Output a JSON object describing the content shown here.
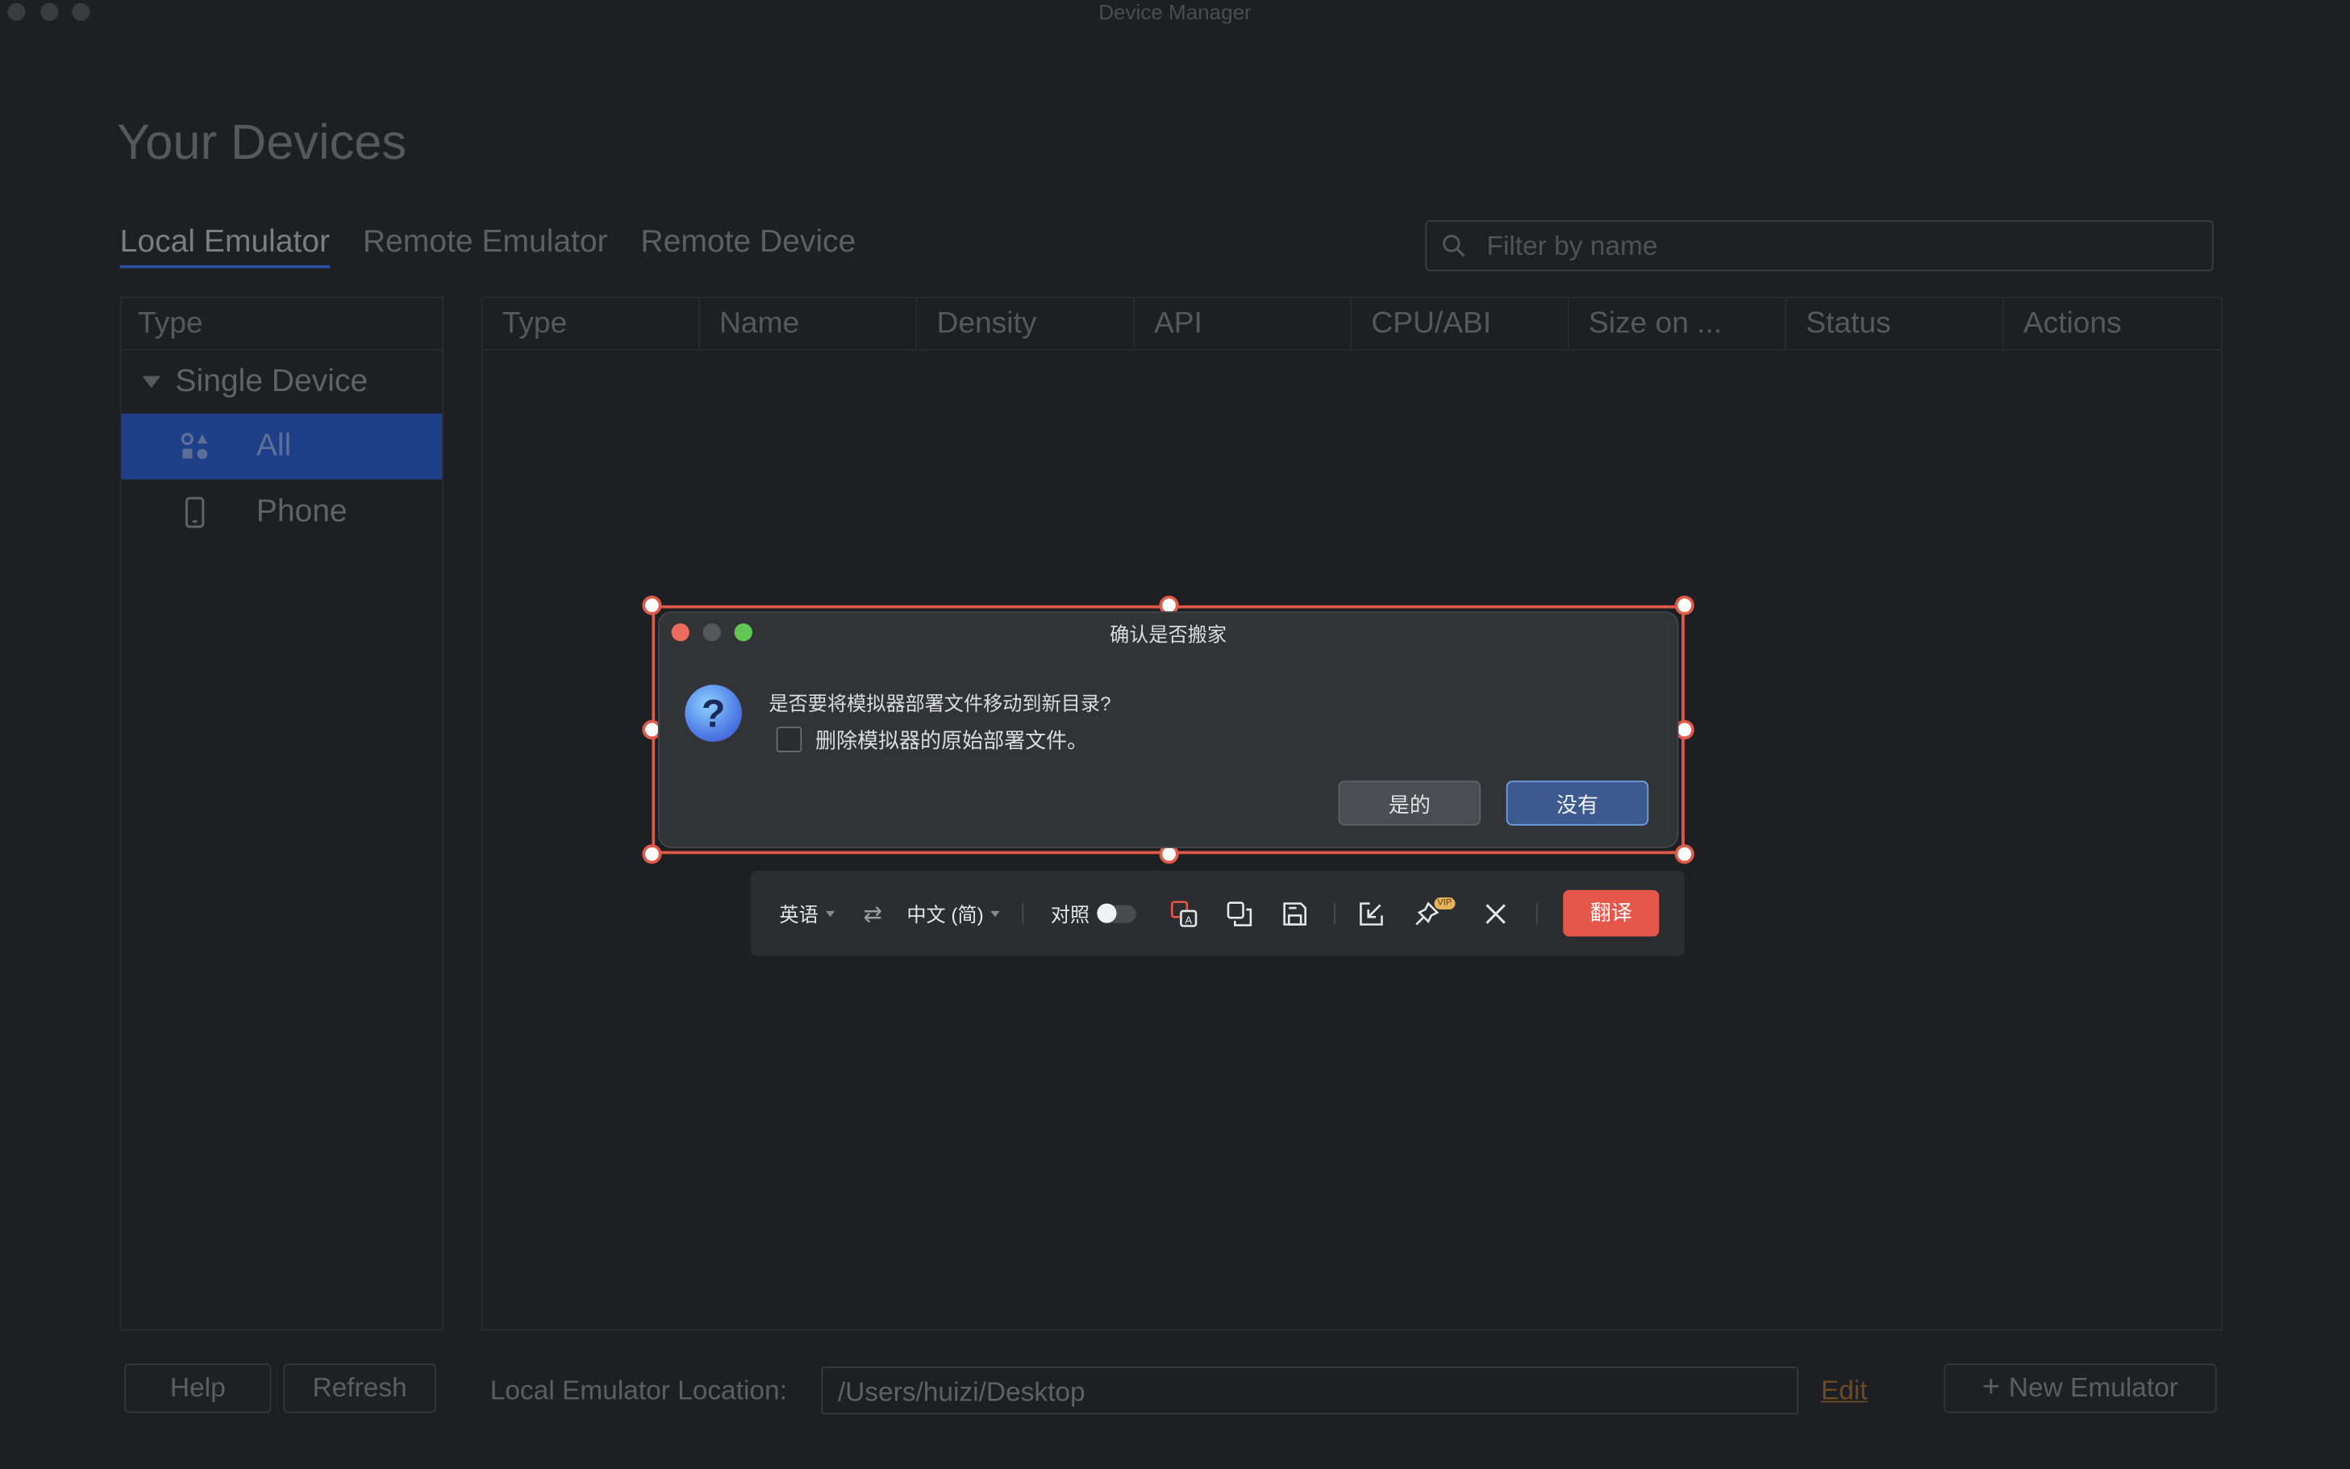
{
  "window": {
    "title": "Device Manager"
  },
  "page": {
    "title": "Your Devices"
  },
  "tabs": [
    {
      "label": "Local Emulator",
      "active": true
    },
    {
      "label": "Remote Emulator",
      "active": false
    },
    {
      "label": "Remote Device",
      "active": false
    }
  ],
  "search": {
    "placeholder": "Filter by name",
    "value": ""
  },
  "sidebar": {
    "header": "Type",
    "group": "Single Device",
    "items": [
      {
        "label": "All",
        "icon": "category-grid-icon",
        "selected": true
      },
      {
        "label": "Phone",
        "icon": "phone-icon",
        "selected": false
      }
    ]
  },
  "table": {
    "columns": [
      "Type",
      "Name",
      "Density",
      "API",
      "CPU/ABI",
      "Size on ...",
      "Status",
      "Actions"
    ]
  },
  "footer": {
    "help_label": "Help",
    "refresh_label": "Refresh",
    "location_label": "Local Emulator Location:",
    "location_value": "/Users/huizi/Desktop",
    "edit_label": "Edit",
    "new_emulator_label": "New Emulator"
  },
  "dialog": {
    "title": "确认是否搬家",
    "icon": "question-icon",
    "message": "是否要将模拟器部署文件移动到新目录?",
    "checkbox_label": "删除模拟器的原始部署文件。",
    "checkbox_checked": false,
    "yes_label": "是的",
    "no_label": "没有"
  },
  "translate_toolbar": {
    "source_lang": "英语",
    "target_lang": "中文 (简)",
    "compare_label": "对照",
    "compare_on": false,
    "vip_badge": "VIP",
    "translate_label": "翻译"
  },
  "colors": {
    "background": "#1e1f22",
    "selection": "#1f3f88",
    "dialog_primary": "#3c5a8e",
    "accent_red": "#e5574a",
    "frame_red": "#e05a47"
  }
}
